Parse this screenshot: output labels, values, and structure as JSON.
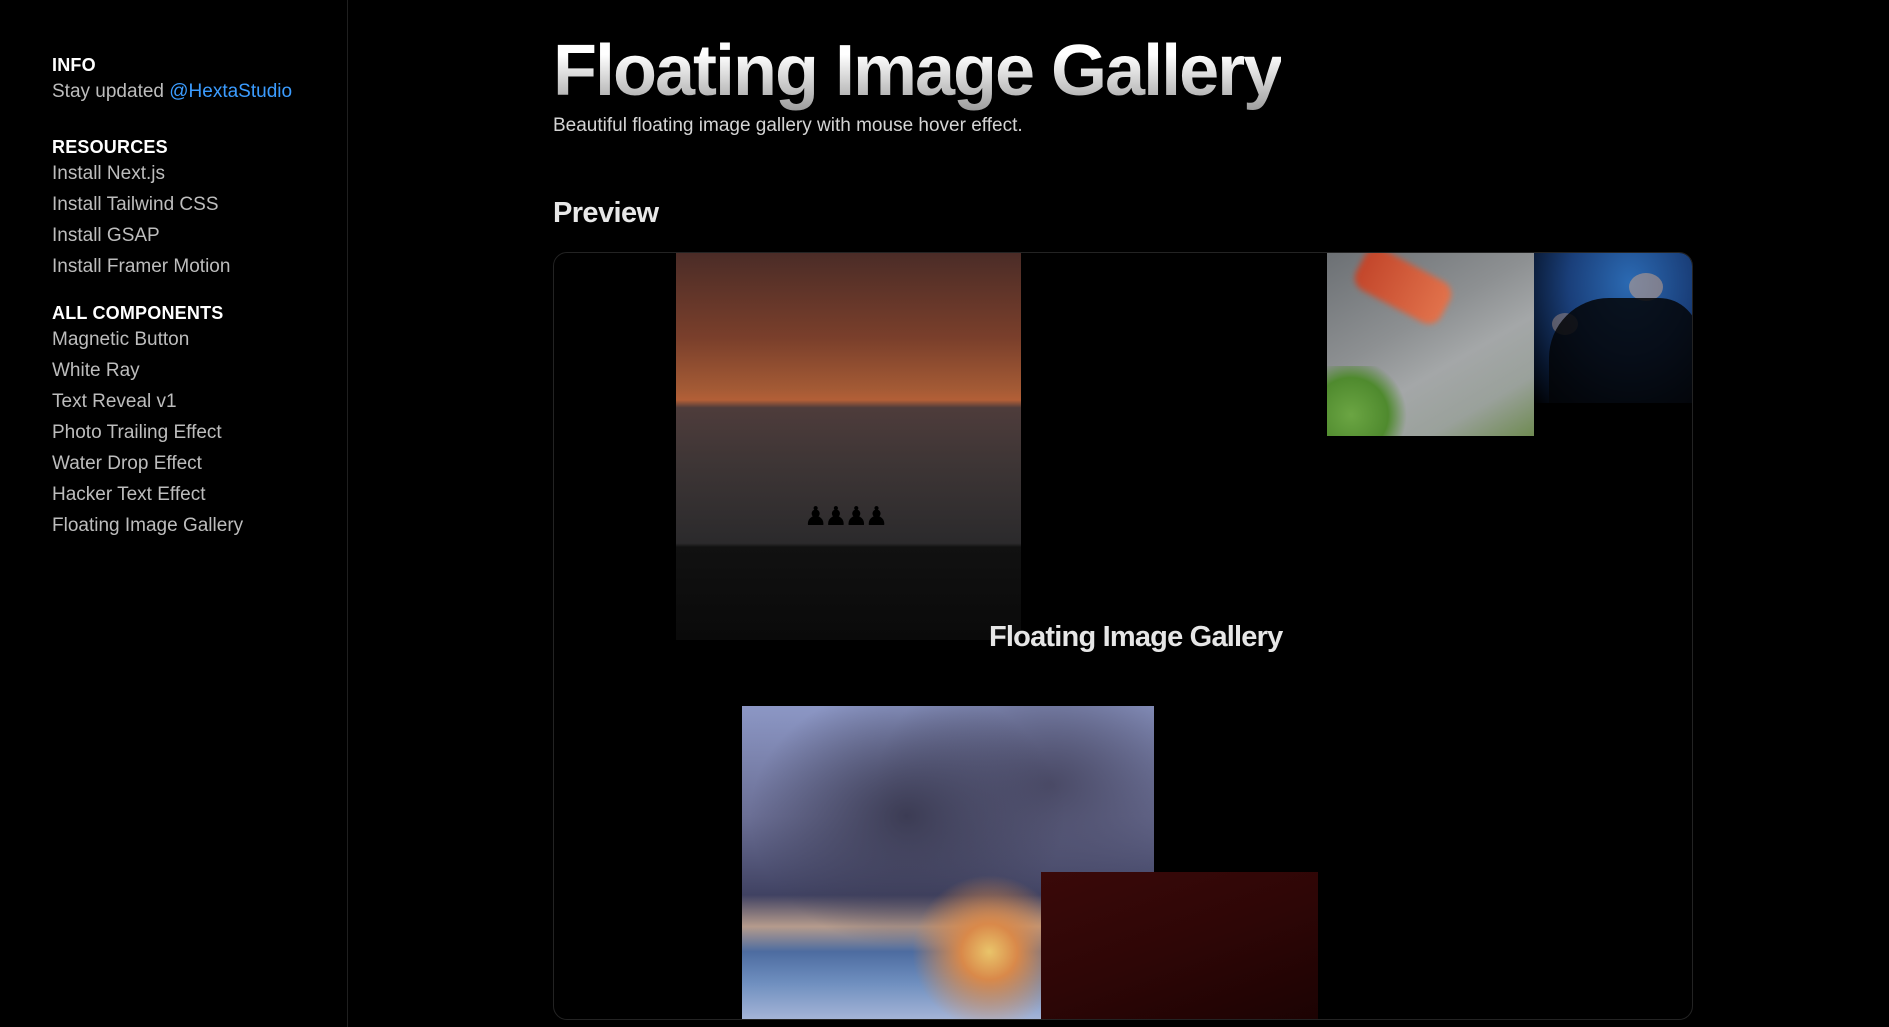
{
  "sidebar": {
    "info": {
      "heading": "INFO",
      "text": "Stay updated",
      "handle": "@HextaStudio"
    },
    "resources": {
      "heading": "RESOURCES",
      "items": [
        "Install Next.js",
        "Install Tailwind CSS",
        "Install GSAP",
        "Install Framer Motion"
      ]
    },
    "components": {
      "heading": "ALL COMPONENTS",
      "items": [
        "Magnetic Button",
        "White Ray",
        "Text Reveal v1",
        "Photo Trailing Effect",
        "Water Drop Effect",
        "Hacker Text Effect",
        "Floating Image Gallery"
      ]
    }
  },
  "main": {
    "title": "Floating Image Gallery",
    "subtitle": "Beautiful floating image gallery with mouse hover effect.",
    "preview_heading": "Preview",
    "preview": {
      "overlay_title": "Floating Image Gallery"
    }
  },
  "colors": {
    "accent": "#3b9cff",
    "background": "#000000"
  }
}
